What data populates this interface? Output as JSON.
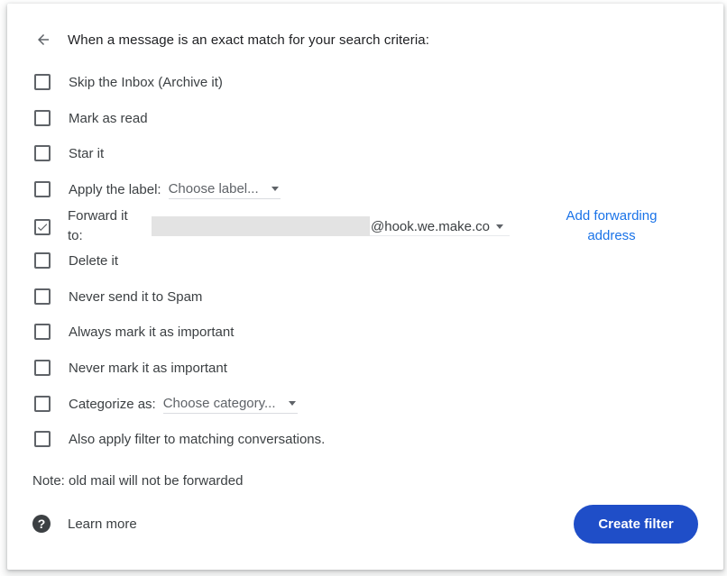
{
  "dialog": {
    "header": "When a message is an exact match for your search criteria:",
    "options": [
      {
        "label": "Skip the Inbox (Archive it)",
        "checked": false
      },
      {
        "label": "Mark as read",
        "checked": false
      },
      {
        "label": "Star it",
        "checked": false
      },
      {
        "label": "Apply the label:",
        "checked": false,
        "select": "Choose label..."
      },
      {
        "label": "Forward it to:",
        "checked": true
      },
      {
        "label": "Delete it",
        "checked": false
      },
      {
        "label": "Never send it to Spam",
        "checked": false
      },
      {
        "label": "Always mark it as important",
        "checked": false
      },
      {
        "label": "Never mark it as important",
        "checked": false
      },
      {
        "label": "Categorize as:",
        "checked": false,
        "select": "Choose category..."
      },
      {
        "label": "Also apply filter to matching conversations.",
        "checked": false
      }
    ],
    "forward": {
      "label_line1": "Forward it",
      "label_line2": "to:",
      "address_domain": "@hook.we.make.co",
      "add_link_line1": "Add forwarding",
      "add_link_line2": "address"
    },
    "note": "Note: old mail will not be forwarded",
    "learn_more": "Learn more",
    "create_button": "Create filter"
  },
  "colors": {
    "accent": "#1f4ec8",
    "link": "#1a73e8",
    "text": "#3c4043"
  },
  "icons": {
    "back": "arrow-left-icon",
    "help": "help-circle-icon",
    "check": "check-icon",
    "caret": "caret-down-icon"
  }
}
